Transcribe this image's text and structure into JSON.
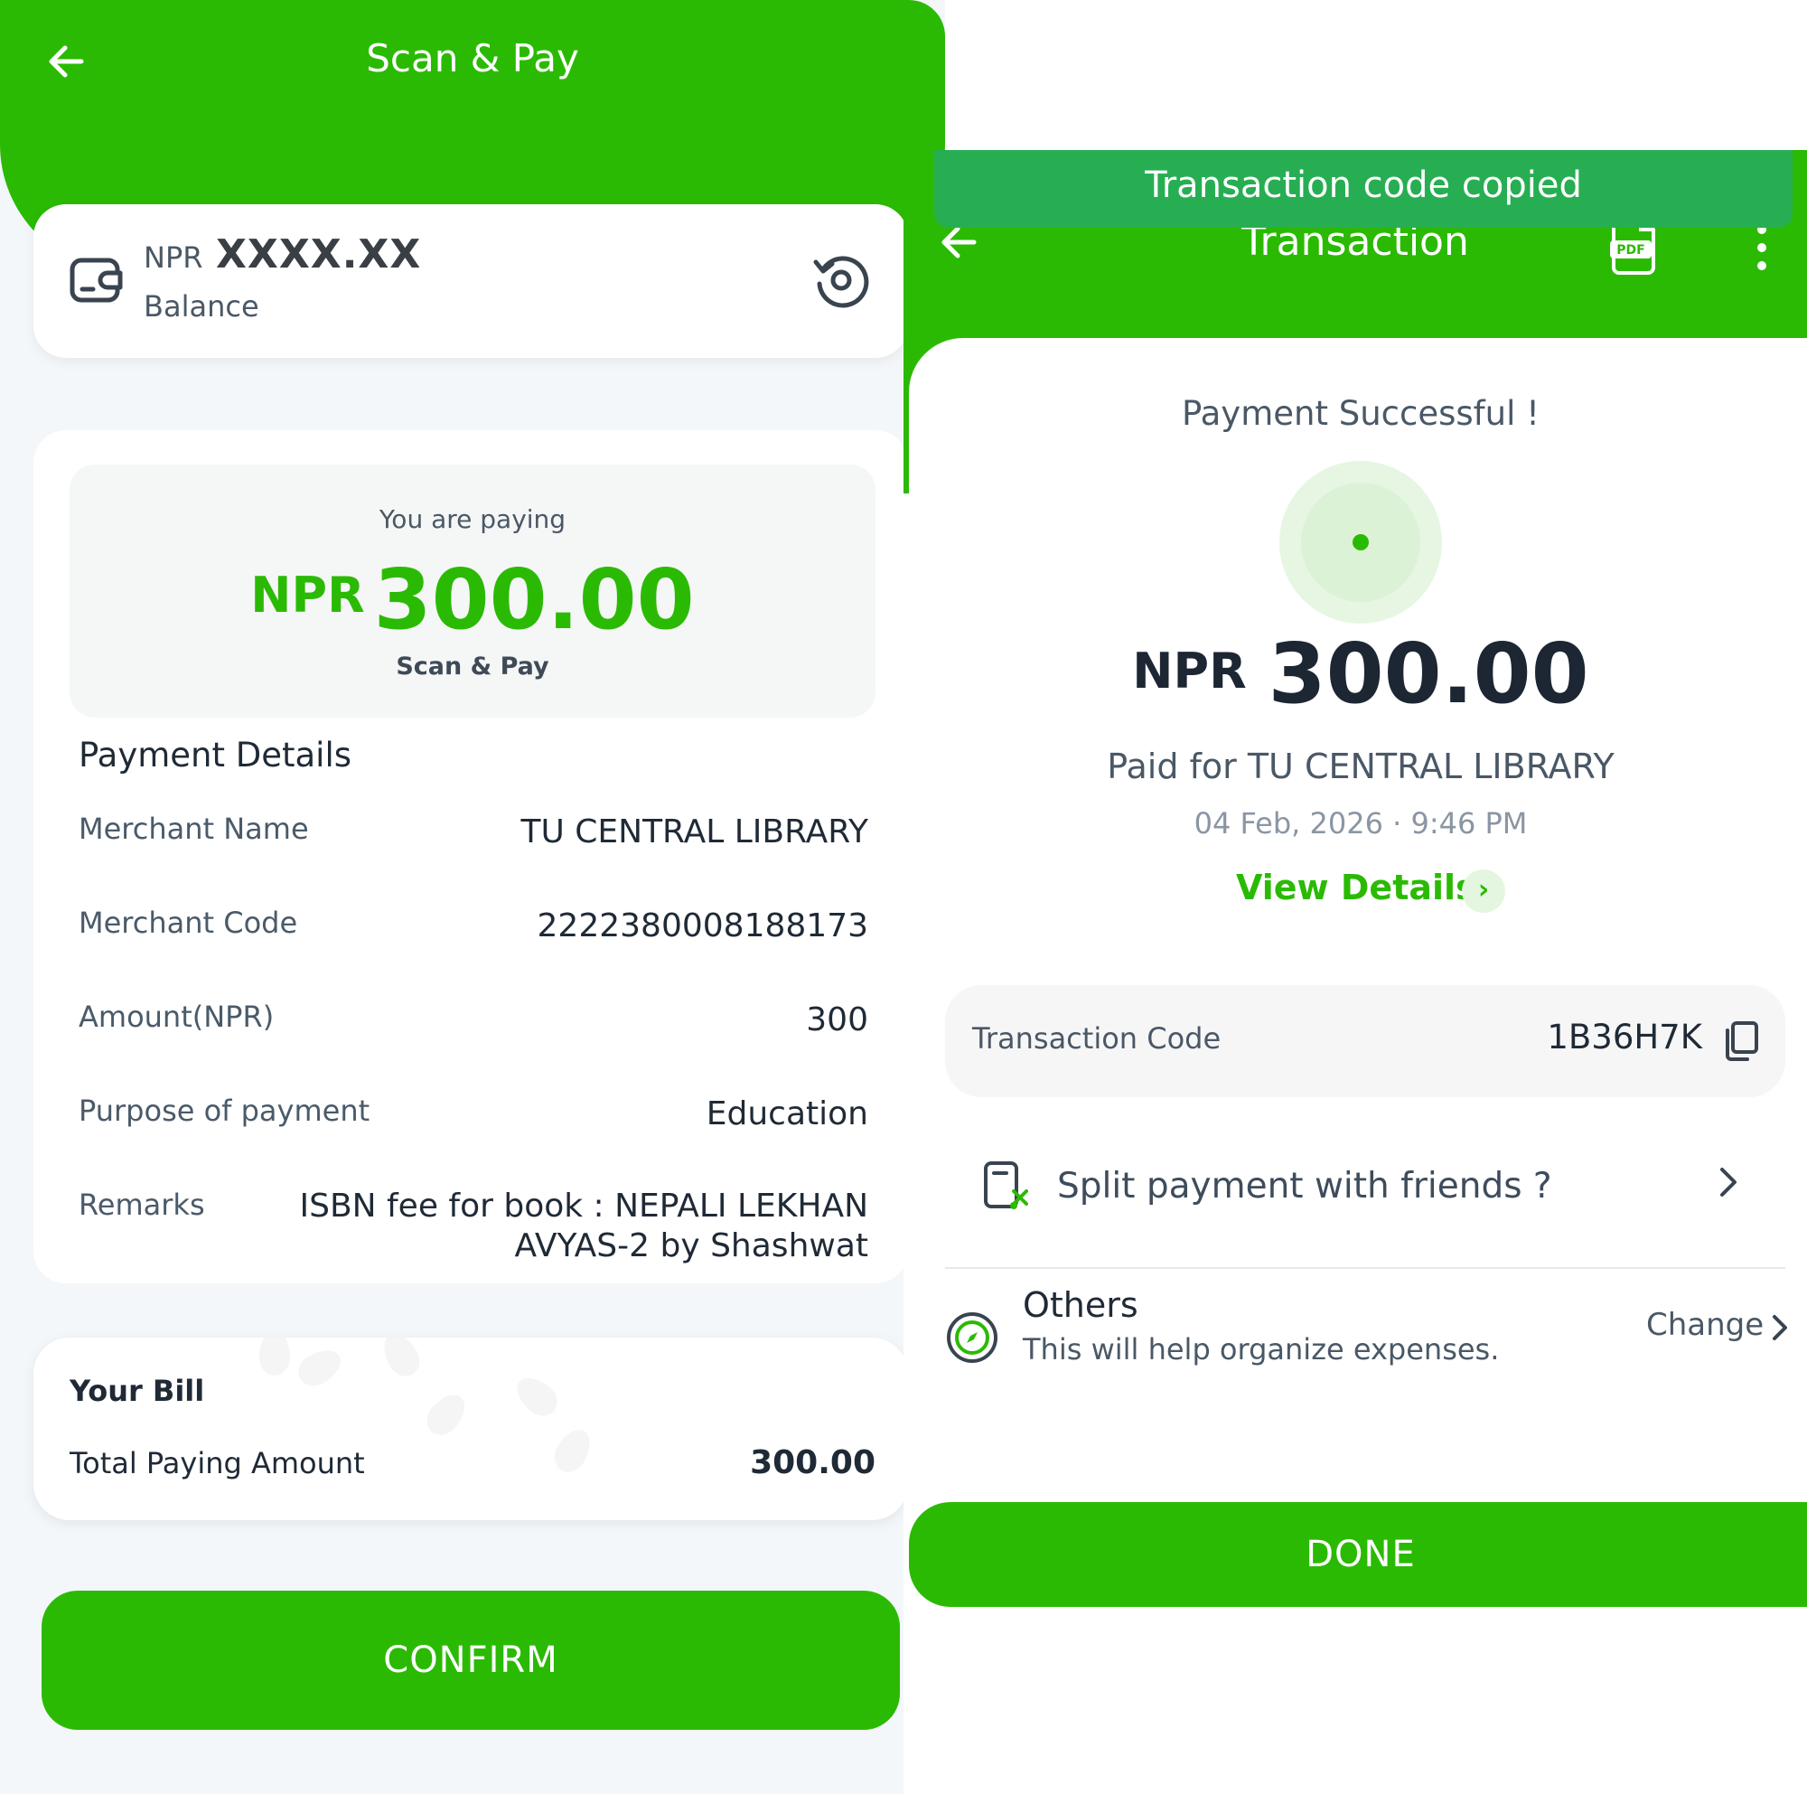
{
  "left_screen": {
    "header": {
      "title": "Scan & Pay",
      "back_icon": "arrow-left-icon"
    },
    "balance": {
      "currency": "NPR",
      "amount": "XXXX.XX",
      "label": "Balance",
      "wallet_icon": "wallet-icon",
      "refresh_icon": "refresh-icon"
    },
    "paying": {
      "label": "You are paying",
      "currency": "NPR",
      "amount": "300.00",
      "service": "Scan & Pay"
    },
    "payment_details": {
      "title": "Payment Details",
      "rows": [
        {
          "label": "Merchant Name",
          "value": "TU CENTRAL LIBRARY"
        },
        {
          "label": "Merchant Code",
          "value": "2222380008188173"
        },
        {
          "label": "Amount(NPR)",
          "value": "300"
        },
        {
          "label": "Purpose of payment",
          "value": "Education"
        },
        {
          "label": "Remarks",
          "value_line1": "ISBN fee for book : NEPALI LEKHAN",
          "value_line2": "AVYAS-2 by Shashwat"
        }
      ]
    },
    "bill": {
      "title": "Your Bill",
      "total_label": "Total Paying Amount",
      "total_value": "300.00"
    },
    "confirm_label": "CONFIRM"
  },
  "right_screen": {
    "toast": "Transaction code copied",
    "header": {
      "title": "Transaction",
      "back_icon": "arrow-left-icon",
      "pdf_icon": "pdf-icon",
      "pdf_label": "PDF",
      "more_icon": "more-vertical-icon"
    },
    "status": "Payment Successful !",
    "amount": {
      "currency": "NPR",
      "value": "300.00"
    },
    "paid_for": "Paid for TU CENTRAL LIBRARY",
    "datetime": "04 Feb, 2026 · 9:46 PM",
    "view_details_label": "View Details",
    "transaction": {
      "label": "Transaction Code",
      "code": "1B36H7K",
      "copy_icon": "copy-icon"
    },
    "split": {
      "label": "Split payment with friends ?",
      "icon": "split-bill-icon"
    },
    "category": {
      "title": "Others",
      "subtitle": "This will help organize expenses.",
      "change_label": "Change",
      "icon": "compass-icon"
    },
    "done_label": "DONE"
  },
  "colors": {
    "brand_green": "#2bba04",
    "toast_green": "#27ae53",
    "text_dark": "#1f2a36",
    "text_muted": "#4a5866"
  }
}
